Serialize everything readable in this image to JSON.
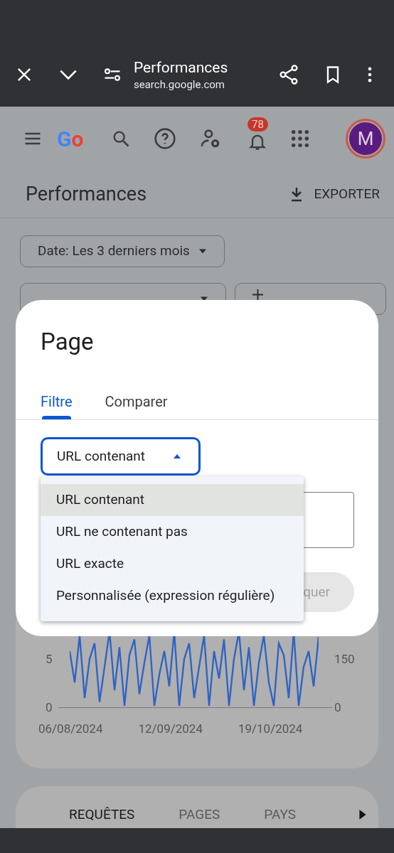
{
  "browser_bar": {
    "title": "Performances",
    "url": "search.google.com"
  },
  "header": {
    "logo": "Go",
    "notification_count": "78",
    "avatar_initial": "M"
  },
  "page_title": "Performances",
  "export_label": "EXPORTER",
  "filters": [
    {
      "kind": "dropdown",
      "label": "Date: Les 3 derniers mois"
    },
    {
      "kind": "dropdown"
    },
    {
      "kind": "add"
    }
  ],
  "chart": {
    "left_ticks": [
      "5",
      "0"
    ],
    "right_ticks": [
      "150",
      "0"
    ],
    "dates": [
      "06/08/2024",
      "12/09/2024",
      "19/10/2024"
    ]
  },
  "report_tabs": [
    {
      "label": "REQUÊTES",
      "selected": true
    },
    {
      "label": "PAGES",
      "selected": false
    },
    {
      "label": "PAYS",
      "selected": false
    }
  ],
  "dialog": {
    "title": "Page",
    "tabs": [
      {
        "label": "Filtre",
        "selected": true
      },
      {
        "label": "Comparer",
        "selected": false
      }
    ],
    "select": {
      "value": "URL contenant",
      "expanded": true
    },
    "options": [
      {
        "label": "URL contenant",
        "selected": true
      },
      {
        "label": "URL ne contenant pas",
        "selected": false
      },
      {
        "label": "URL exacte",
        "selected": false
      },
      {
        "label": "Personnalisée (expression régulière)",
        "selected": false
      }
    ],
    "apply_label": "quer"
  }
}
